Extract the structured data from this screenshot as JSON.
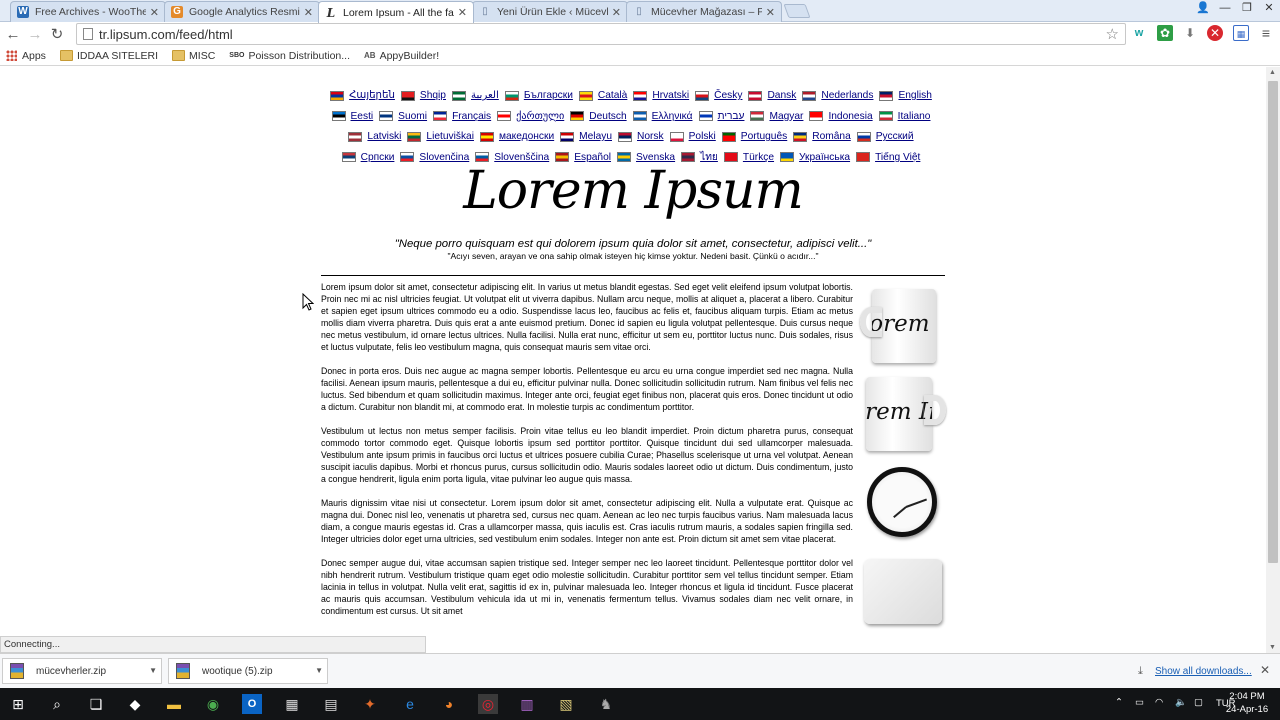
{
  "tabs": [
    {
      "title": "Free Archives - WooThem",
      "icon": "W",
      "icon_color": "#2a6bb5",
      "active": false
    },
    {
      "title": "Google Analytics Resmi W",
      "icon": "G",
      "icon_color": "#e48a2b",
      "active": false
    },
    {
      "title": "Lorem Ipsum - All the fact",
      "icon": "L",
      "icon_color": "#333333",
      "active": true
    },
    {
      "title": "Yeni Ürün Ekle ‹ Mücevher",
      "icon": "▯",
      "icon_color": "#8b9bb4",
      "active": false
    },
    {
      "title": "Mücevher Mağazası – Pre",
      "icon": "▯",
      "icon_color": "#8b9bb4",
      "active": false
    }
  ],
  "toolbar": {
    "url": "tr.lipsum.com/feed/html",
    "back_icon": "←",
    "forward_icon": "→",
    "reload_icon": "↻"
  },
  "bookmarks": [
    {
      "label": "Apps",
      "icon": "apps-grid"
    },
    {
      "label": "IDDAA SITELERI",
      "icon": "folder"
    },
    {
      "label": "MISC",
      "icon": "folder"
    },
    {
      "label": "Poisson Distribution...",
      "icon": "sbo"
    },
    {
      "label": "AppyBuilder!",
      "icon": "appy"
    }
  ],
  "languages": [
    {
      "name": "Հայերեն",
      "flag": [
        "#d90012",
        "#0033a0",
        "#f2a800"
      ]
    },
    {
      "name": "Shqip",
      "flag": [
        "#e41e20",
        "#e41e20",
        "#111111"
      ]
    },
    {
      "name": "العربية",
      "flag": [
        "#006c35",
        "#ffffff",
        "#006c35"
      ]
    },
    {
      "name": "Български",
      "flag": [
        "#ffffff",
        "#00966e",
        "#d62612"
      ]
    },
    {
      "name": "Català",
      "flag": [
        "#fcdd09",
        "#da121a",
        "#fcdd09"
      ]
    },
    {
      "name": "Hrvatski",
      "flag": [
        "#ff0000",
        "#ffffff",
        "#171796"
      ]
    },
    {
      "name": "Česky",
      "flag": [
        "#ffffff",
        "#d7141a",
        "#11457e"
      ]
    },
    {
      "name": "Dansk",
      "flag": [
        "#c60c30",
        "#ffffff",
        "#c60c30"
      ]
    },
    {
      "name": "Nederlands",
      "flag": [
        "#ae1c28",
        "#ffffff",
        "#21468b"
      ]
    },
    {
      "name": "English",
      "flag": [
        "#012169",
        "#c8102e",
        "#ffffff"
      ]
    },
    {
      "name": "Eesti",
      "flag": [
        "#0072ce",
        "#000000",
        "#ffffff"
      ]
    },
    {
      "name": "Suomi",
      "flag": [
        "#ffffff",
        "#003580",
        "#ffffff"
      ]
    },
    {
      "name": "Français",
      "flag": [
        "#002395",
        "#ffffff",
        "#ed2939"
      ]
    },
    {
      "name": "ქართული",
      "flag": [
        "#ffffff",
        "#ff0000",
        "#ffffff"
      ]
    },
    {
      "name": "Deutsch",
      "flag": [
        "#000000",
        "#dd0000",
        "#ffce00"
      ]
    },
    {
      "name": "Ελληνικά",
      "flag": [
        "#0d5eaf",
        "#ffffff",
        "#0d5eaf"
      ]
    },
    {
      "name": "עברית",
      "flag": [
        "#ffffff",
        "#0038b8",
        "#ffffff"
      ]
    },
    {
      "name": "Magyar",
      "flag": [
        "#ce2939",
        "#ffffff",
        "#477050"
      ]
    },
    {
      "name": "Indonesia",
      "flag": [
        "#ff0000",
        "#ff0000",
        "#ffffff"
      ]
    },
    {
      "name": "Italiano",
      "flag": [
        "#009246",
        "#ffffff",
        "#ce2b37"
      ]
    },
    {
      "name": "Latviski",
      "flag": [
        "#9e3039",
        "#ffffff",
        "#9e3039"
      ]
    },
    {
      "name": "Lietuviškai",
      "flag": [
        "#fdb913",
        "#006a44",
        "#c1272d"
      ]
    },
    {
      "name": "македонски",
      "flag": [
        "#d20000",
        "#ffe600",
        "#d20000"
      ]
    },
    {
      "name": "Melayu",
      "flag": [
        "#cc0001",
        "#ffffff",
        "#010066"
      ]
    },
    {
      "name": "Norsk",
      "flag": [
        "#ba0c2f",
        "#00205b",
        "#ffffff"
      ]
    },
    {
      "name": "Polski",
      "flag": [
        "#ffffff",
        "#ffffff",
        "#dc143c"
      ]
    },
    {
      "name": "Português",
      "flag": [
        "#006600",
        "#ff0000",
        "#ff0000"
      ]
    },
    {
      "name": "Româna",
      "flag": [
        "#002b7f",
        "#fcd116",
        "#ce1126"
      ]
    },
    {
      "name": "Pусский",
      "flag": [
        "#ffffff",
        "#0039a6",
        "#d52b1e"
      ]
    },
    {
      "name": "Српски",
      "flag": [
        "#c6363c",
        "#0c4076",
        "#ffffff"
      ]
    },
    {
      "name": "Slovenčina",
      "flag": [
        "#ffffff",
        "#0b4ea2",
        "#ee1c25"
      ]
    },
    {
      "name": "Slovenščina",
      "flag": [
        "#ffffff",
        "#005da4",
        "#ed1c24"
      ]
    },
    {
      "name": "Español",
      "flag": [
        "#aa151b",
        "#f1bf00",
        "#aa151b"
      ]
    },
    {
      "name": "Svenska",
      "flag": [
        "#006aa7",
        "#fecc00",
        "#006aa7"
      ]
    },
    {
      "name": "ไทย",
      "flag": [
        "#a51931",
        "#2d2a4a",
        "#a51931"
      ]
    },
    {
      "name": "Türkçe",
      "flag": [
        "#e30a17",
        "#e30a17",
        "#e30a17"
      ]
    },
    {
      "name": "Українська",
      "flag": [
        "#0057b7",
        "#0057b7",
        "#ffd700"
      ]
    },
    {
      "name": "Tiếng Việt",
      "flag": [
        "#da251d",
        "#da251d",
        "#da251d"
      ]
    }
  ],
  "header": {
    "logo": "Lorem Ipsum",
    "quote": "\"Neque porro quisquam est qui dolorem ipsum quia dolor sit amet, consectetur, adipisci velit...\"",
    "subquote": "\"Acıyı seven, arayan ve ona sahip olmak isteyen hiç kimse yoktur. Nedeni basit. Çünkü o acıdır...\""
  },
  "paragraphs": [
    "Lorem ipsum dolor sit amet, consectetur adipiscing elit. In varius ut metus blandit egestas. Sed eget velit eleifend ipsum volutpat lobortis. Proin nec mi ac nisl ultricies feugiat. Ut volutpat elit ut viverra dapibus. Nullam arcu neque, mollis at aliquet a, placerat a libero. Curabitur et sapien eget ipsum ultrices commodo eu a odio. Suspendisse lacus leo, faucibus ac felis et, faucibus aliquam turpis. Etiam ac metus mollis diam viverra pharetra. Duis quis erat a ante euismod pretium. Donec id sapien eu ligula volutpat pellentesque. Duis cursus neque nec metus vestibulum, id ornare lectus ultrices. Nulla facilisi. Nulla erat nunc, efficitur ut sem eu, porttitor luctus nunc. Duis sodales, risus et luctus vulputate, felis leo vestibulum magna, quis consequat mauris sem vitae orci.",
    "Donec in porta eros. Duis nec augue ac magna semper lobortis. Pellentesque eu arcu eu urna congue imperdiet sed nec magna. Nulla facilisi. Aenean ipsum mauris, pellentesque a dui eu, efficitur pulvinar nulla. Donec sollicitudin sollicitudin rutrum. Nam finibus vel felis nec luctus. Sed bibendum et quam sollicitudin maximus. Integer ante orci, feugiat eget finibus non, placerat quis eros. Donec tincidunt ut odio a dictum. Curabitur non blandit mi, at commodo erat. In molestie turpis ac condimentum porttitor.",
    "Vestibulum ut lectus non metus semper facilisis. Proin vitae tellus eu leo blandit imperdiet. Proin dictum pharetra purus, consequat commodo tortor commodo eget. Quisque lobortis ipsum sed porttitor porttitor. Quisque tincidunt dui sed ullamcorper malesuada. Vestibulum ante ipsum primis in faucibus orci luctus et ultrices posuere cubilia Curae; Phasellus scelerisque ut urna vel volutpat. Aenean suscipit iaculis dapibus. Morbi et rhoncus purus, cursus sollicitudin odio. Mauris sodales laoreet odio ut dictum. Duis condimentum, justo a congue hendrerit, ligula enim porta ligula, vitae pulvinar leo augue quis massa.",
    "Mauris dignissim vitae nisi ut consectetur. Lorem ipsum dolor sit amet, consectetur adipiscing elit. Nulla a vulputate erat. Quisque ac magna dui. Donec nisl leo, venenatis ut pharetra sed, cursus nec quam. Aenean ac leo nec turpis faucibus varius. Nam malesuada lacus diam, a congue mauris egestas id. Cras a ullamcorper massa, quis iaculis est. Cras iaculis rutrum mauris, a sodales sapien fringilla sed. Integer ultricies dolor eget urna ultricies, sed vestibulum enim sodales. Integer non ante est. Proin dictum sit amet sem vitae placerat.",
    "Donec semper augue dui, vitae accumsan sapien tristique sed. Integer semper nec leo laoreet tincidunt. Pellentesque porttitor dolor vel nibh hendrerit rutrum. Vestibulum tristique quam eget odio molestie sollicitudin. Curabitur porttitor sem vel tellus tincidunt semper. Etiam lacinia in tellus in volutpat. Nulla velit erat, sagittis id ex in, pulvinar malesuada leo. Integer rhoncus et ligula id tincidunt. Fusce placerat ac mauris quis accumsan. Vestibulum vehicula ida ut mi in, venenatis fermentum tellus. Vivamus sodales diam nec velit ornare, in condimentum est cursus. Ut sit amet"
  ],
  "product_images": {
    "mug1_text": "Lorem Ipsum",
    "mug2_text": "Lorem Ipsum"
  },
  "status": {
    "text": "Connecting..."
  },
  "downloads": {
    "items": [
      {
        "name": "mücevherler.zip"
      },
      {
        "name": "wootique (5).zip"
      }
    ],
    "show_all": "Show all downloads..."
  },
  "taskbar": {
    "lang": "TUR",
    "time": "2:04 PM",
    "date": "24-Apr-16"
  }
}
